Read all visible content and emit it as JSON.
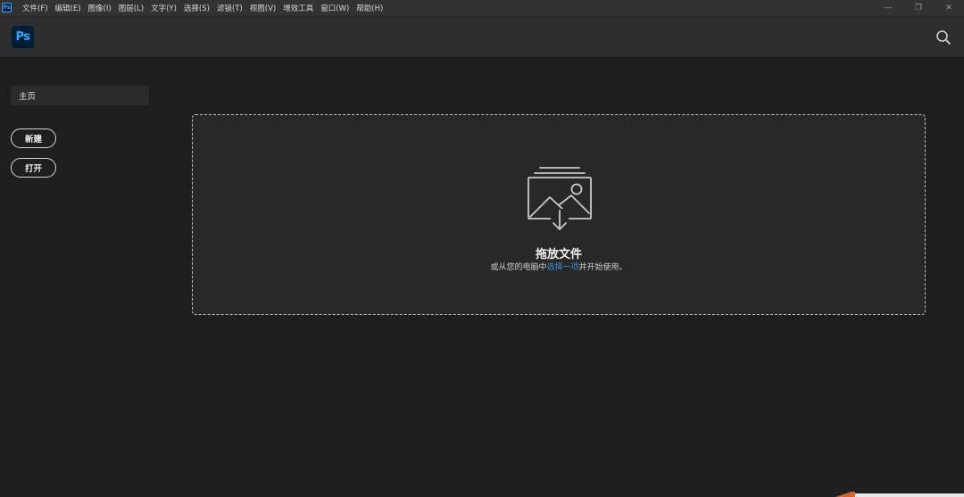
{
  "app": {
    "mini_logo": "Ps",
    "logo": "Ps"
  },
  "menubar": {
    "items": [
      "文件(F)",
      "编辑(E)",
      "图像(I)",
      "图层(L)",
      "文字(Y)",
      "选择(S)",
      "滤镜(T)",
      "视图(V)",
      "增效工具",
      "窗口(W)",
      "帮助(H)"
    ],
    "window_controls": {
      "minimize": "—",
      "restore": "❐",
      "close": "✕"
    }
  },
  "header": {
    "search_icon": "search-icon"
  },
  "sidebar": {
    "home_label": "主页",
    "new_label": "新建",
    "open_label": "打开"
  },
  "dropzone": {
    "title": "拖放文件",
    "sub_prefix": "或从您的电脑中",
    "sub_link": "选择一项",
    "sub_suffix": "并开始使用。",
    "icon": "image-import-icon"
  },
  "colors": {
    "brand": "#31a8ff",
    "brand_bg": "#001e36",
    "link": "#3e8ede",
    "background": "#1e1e1e"
  }
}
